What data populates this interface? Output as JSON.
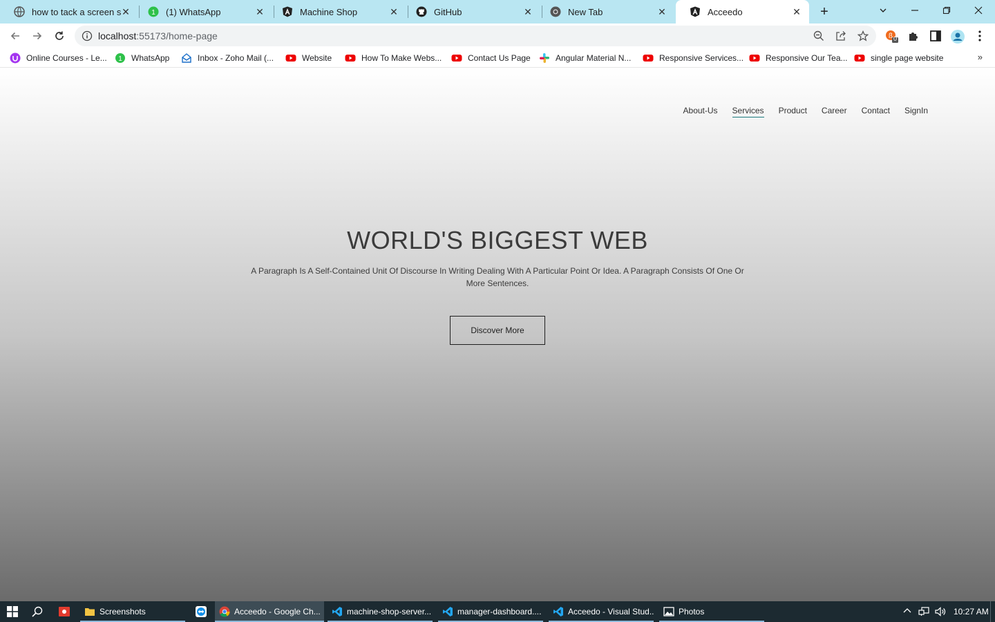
{
  "browser": {
    "tabs": [
      {
        "title": "how to tack a screen sho",
        "icon": "globe-icon"
      },
      {
        "title": "(1) WhatsApp",
        "icon": "whatsapp-icon"
      },
      {
        "title": "Machine Shop",
        "icon": "angular-icon"
      },
      {
        "title": "GitHub",
        "icon": "github-icon"
      },
      {
        "title": "New Tab",
        "icon": "chrome-icon"
      },
      {
        "title": "Acceedo",
        "icon": "angular-icon",
        "active": true
      }
    ],
    "url_host": "localhost",
    "url_path": ":55173/home-page",
    "bookmarks": [
      {
        "label": "Online Courses - Le...",
        "icon": "udemy-icon"
      },
      {
        "label": "WhatsApp",
        "icon": "whatsapp-icon"
      },
      {
        "label": "Inbox - Zoho Mail (...",
        "icon": "zoho-mail-icon"
      },
      {
        "label": "Website",
        "icon": "youtube-icon"
      },
      {
        "label": "How To Make Webs...",
        "icon": "youtube-icon"
      },
      {
        "label": "Contact Us Page",
        "icon": "youtube-icon"
      },
      {
        "label": "Angular Material N...",
        "icon": "slack-icon"
      },
      {
        "label": "Responsive Services...",
        "icon": "youtube-icon"
      },
      {
        "label": "Responsive Our Tea...",
        "icon": "youtube-icon"
      },
      {
        "label": "single page website",
        "icon": "youtube-icon"
      }
    ],
    "extension_badge": "0",
    "more_bookmarks": "»"
  },
  "site": {
    "nav": [
      "About-Us",
      "Services",
      "Product",
      "Career",
      "Contact",
      "SignIn"
    ],
    "active_nav": "Services",
    "hero_title": "WORLD'S BIGGEST WEB",
    "hero_text": "A Paragraph Is A Self-Contained Unit Of Discourse In Writing Dealing With A Particular Point Or Idea. A Paragraph Consists Of One Or More Sentences.",
    "cta_label": "Discover More",
    "accent_color": "#1a7b7f"
  },
  "taskbar": {
    "tasks": [
      {
        "label": "Screenshots",
        "icon": "folder-icon"
      },
      {
        "label": "",
        "icon": "teamviewer-icon"
      },
      {
        "label": "Acceedo - Google Ch...",
        "icon": "chrome-icon"
      },
      {
        "label": "machine-shop-server...",
        "icon": "vscode-icon"
      },
      {
        "label": "manager-dashboard....",
        "icon": "vscode-icon"
      },
      {
        "label": "Acceedo - Visual Stud...",
        "icon": "vscode-icon"
      },
      {
        "label": "Photos",
        "icon": "photos-icon"
      }
    ],
    "time": "10:27 AM"
  }
}
